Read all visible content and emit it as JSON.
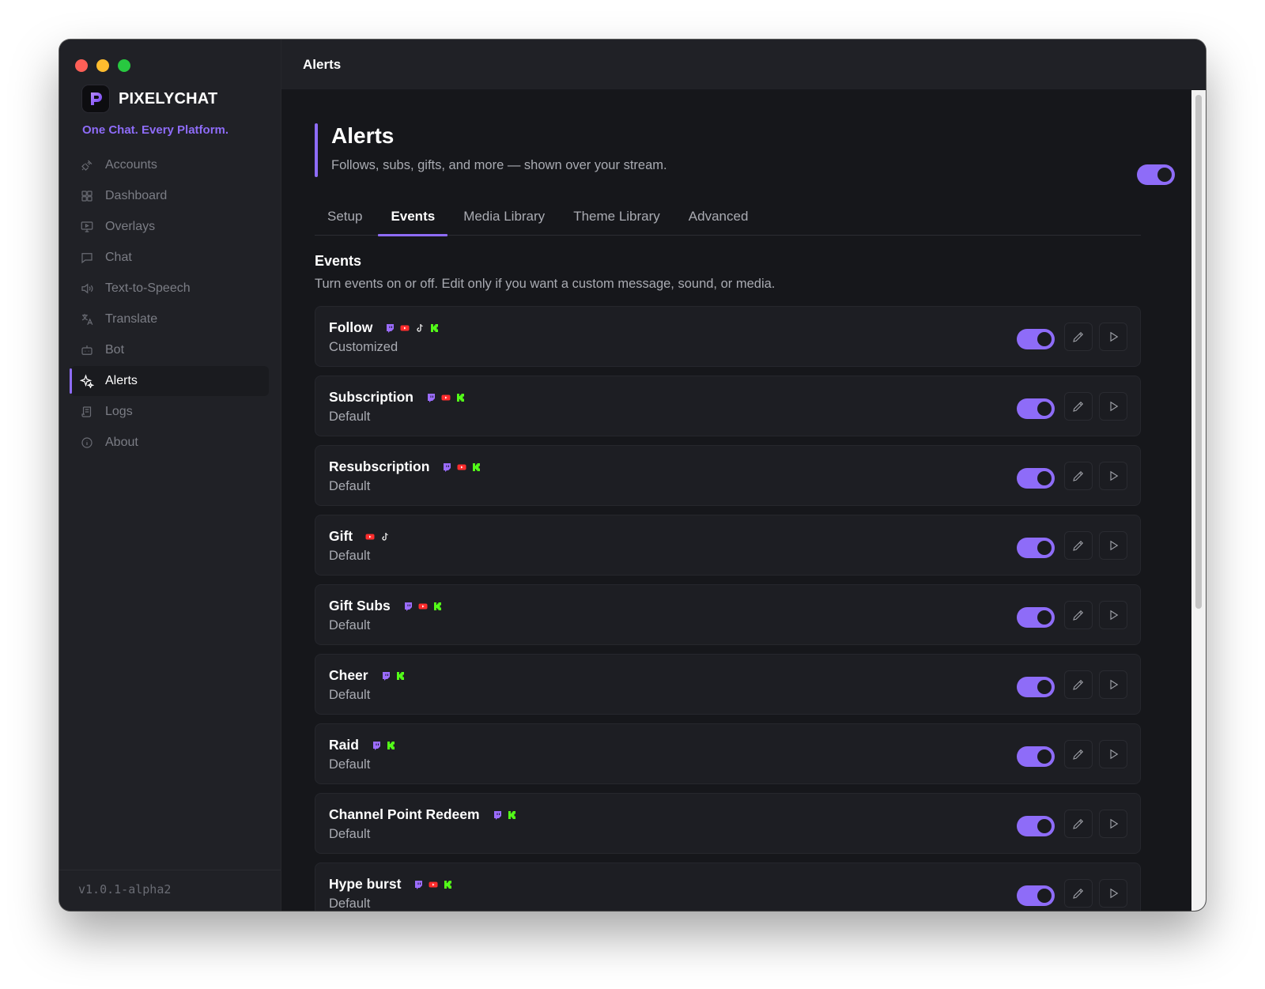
{
  "app": {
    "brand_name": "PIXELYCHAT",
    "tagline": "One Chat. Every Platform.",
    "version": "v1.0.1-alpha2",
    "window_title": "Alerts",
    "accent_color": "#8e6cf8"
  },
  "sidebar": {
    "items": [
      {
        "label": "Accounts",
        "icon": "plug-icon"
      },
      {
        "label": "Dashboard",
        "icon": "grid-icon"
      },
      {
        "label": "Overlays",
        "icon": "monitor-icon"
      },
      {
        "label": "Chat",
        "icon": "chat-icon"
      },
      {
        "label": "Text-to-Speech",
        "icon": "speaker-icon"
      },
      {
        "label": "Translate",
        "icon": "translate-icon"
      },
      {
        "label": "Bot",
        "icon": "bot-icon"
      },
      {
        "label": "Alerts",
        "icon": "sparkle-icon",
        "active": true
      },
      {
        "label": "Logs",
        "icon": "scroll-icon"
      },
      {
        "label": "About",
        "icon": "info-icon"
      }
    ]
  },
  "page": {
    "title": "Alerts",
    "subtitle": "Follows, subs, gifts, and more — shown over your stream.",
    "master_enabled": true
  },
  "tabs": [
    {
      "label": "Setup"
    },
    {
      "label": "Events",
      "active": true
    },
    {
      "label": "Media Library"
    },
    {
      "label": "Theme Library"
    },
    {
      "label": "Advanced"
    }
  ],
  "events_section": {
    "title": "Events",
    "description": "Turn events on or off. Edit only if you want a custom message, sound, or media.",
    "items": [
      {
        "name": "Follow",
        "status": "Customized",
        "platforms": [
          "twitch",
          "youtube",
          "tiktok",
          "kick"
        ],
        "enabled": true
      },
      {
        "name": "Subscription",
        "status": "Default",
        "platforms": [
          "twitch",
          "youtube",
          "kick"
        ],
        "enabled": true
      },
      {
        "name": "Resubscription",
        "status": "Default",
        "platforms": [
          "twitch",
          "youtube",
          "kick"
        ],
        "enabled": true
      },
      {
        "name": "Gift",
        "status": "Default",
        "platforms": [
          "youtube",
          "tiktok"
        ],
        "enabled": true
      },
      {
        "name": "Gift Subs",
        "status": "Default",
        "platforms": [
          "twitch",
          "youtube",
          "kick"
        ],
        "enabled": true
      },
      {
        "name": "Cheer",
        "status": "Default",
        "platforms": [
          "twitch",
          "kick"
        ],
        "enabled": true
      },
      {
        "name": "Raid",
        "status": "Default",
        "platforms": [
          "twitch",
          "kick"
        ],
        "enabled": true
      },
      {
        "name": "Channel Point Redeem",
        "status": "Default",
        "platforms": [
          "twitch",
          "kick"
        ],
        "enabled": true
      },
      {
        "name": "Hype burst",
        "status": "Default",
        "platforms": [
          "twitch",
          "youtube",
          "kick"
        ],
        "enabled": true
      }
    ]
  }
}
